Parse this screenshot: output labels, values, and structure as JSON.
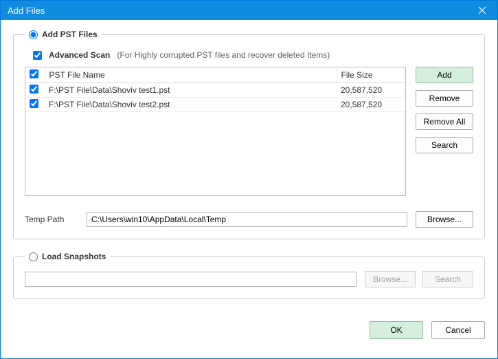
{
  "window": {
    "title": "Add Files"
  },
  "addPst": {
    "legend": "Add PST Files",
    "selected": true,
    "advancedScan": {
      "checked": true,
      "label": "Advanced Scan",
      "hint": "(For Highly corrupted PST files and recover deleted Items)"
    },
    "table": {
      "headerCheck": true,
      "columns": {
        "name": "PST File Name",
        "size": "File Size"
      },
      "rows": [
        {
          "checked": true,
          "name": "F:\\PST File\\Data\\Shoviv test1.pst",
          "size": "20,587,520"
        },
        {
          "checked": true,
          "name": "F:\\PST File\\Data\\Shoviv test2.pst",
          "size": "20,587,520"
        }
      ]
    },
    "buttons": {
      "add": "Add",
      "remove": "Remove",
      "removeAll": "Remove All",
      "search": "Search"
    },
    "tempPath": {
      "label": "Temp Path",
      "value": "C:\\Users\\win10\\AppData\\Local\\Temp",
      "browse": "Browse..."
    }
  },
  "loadSnapshots": {
    "legend": "Load Snapshots",
    "selected": false,
    "value": "",
    "buttons": {
      "browse": "Browse...",
      "search": "Search"
    }
  },
  "footer": {
    "ok": "OK",
    "cancel": "Cancel"
  }
}
